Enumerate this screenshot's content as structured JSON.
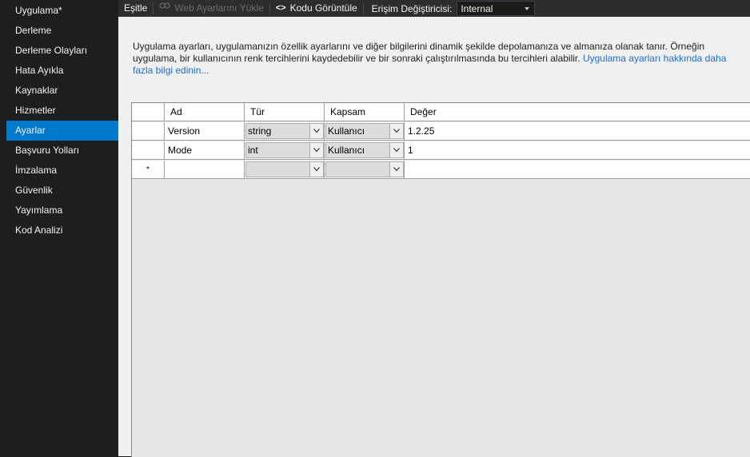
{
  "sidebar": {
    "items": [
      {
        "label": "Uygulama*"
      },
      {
        "label": "Derleme"
      },
      {
        "label": "Derleme Olayları"
      },
      {
        "label": "Hata Ayıkla"
      },
      {
        "label": "Kaynaklar"
      },
      {
        "label": "Hizmetler"
      },
      {
        "label": "Ayarlar",
        "active": true
      },
      {
        "label": "Başvuru Yolları"
      },
      {
        "label": "İmzalama"
      },
      {
        "label": "Güvenlik"
      },
      {
        "label": "Yayımlama"
      },
      {
        "label": "Kod Analizi"
      }
    ]
  },
  "toolbar": {
    "sync_label": "Eşitle",
    "load_web_label": "Web Ayarlarını Yükle",
    "view_code_label": "Kodu Görüntüle",
    "view_code_icon": "<>",
    "access_modifier_label": "Erişim Değiştiricisi:",
    "access_modifier_value": "Internal"
  },
  "main": {
    "description": "Uygulama ayarları, uygulamanızın özellik ayarlarını ve diğer bilgilerini dinamik şekilde depolamanıza ve almanıza olanak tanır. Örneğin uygulama, bir kullanıcının renk tercihlerini kaydedebilir ve bir sonraki çalıştırılmasında bu tercihleri alabilir.",
    "link_text": "Uygulama ayarları hakkında daha fazla bilgi edinin..."
  },
  "grid": {
    "headers": {
      "name": "Ad",
      "type": "Tür",
      "scope": "Kapsam",
      "value": "Değer"
    },
    "rows": [
      {
        "name": "Version",
        "type": "string",
        "scope": "Kullanıcı",
        "value": "1.2.25"
      },
      {
        "name": "Mode",
        "type": "int",
        "scope": "Kullanıcı",
        "value": "1"
      }
    ],
    "new_row_marker": "*"
  },
  "colors": {
    "accent": "#007acc",
    "sidebar_bg": "#1e1e1e",
    "toolbar_bg": "#2d2d30",
    "content_bg": "#f0f0f0",
    "link": "#1e6fc7"
  }
}
